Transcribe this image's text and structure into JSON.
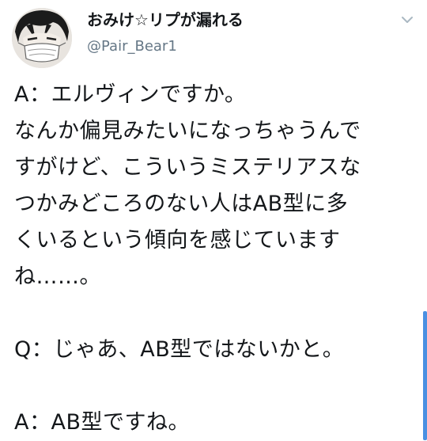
{
  "tweet": {
    "display_name": "おみけ☆リプが漏れる",
    "handle": "@Pair_Bear1",
    "text": "A：エルヴィンですか。\nなんか偏見みたいになっちゃうんで\nすがけど、こういうミステリアスな\nつかみどころのない人はAB型に多\nくいるという傾向を感じています\nね……。\n\nQ：じゃあ、AB型ではないかと。\n\nA：AB型ですね。",
    "caret_icon": "chevron-down-icon",
    "avatar_icon": "avatar"
  },
  "colors": {
    "text": "#14171a",
    "handle": "#657786",
    "caret": "#aab8c2",
    "scrollbar": "#4a90e2"
  }
}
